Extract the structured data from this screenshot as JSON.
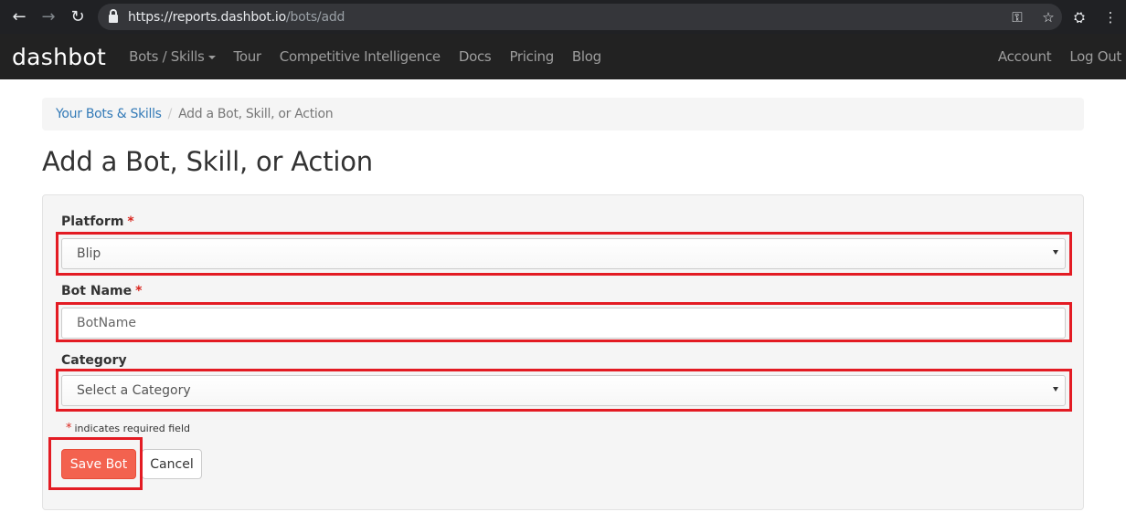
{
  "browser": {
    "url_host": "https://reports.dashbot.io",
    "url_path": "/bots/add",
    "icons": [
      "back-icon",
      "forward-icon",
      "reload-icon",
      "lock-icon",
      "key-icon",
      "star-icon",
      "extension-icon",
      "menu-icon"
    ]
  },
  "navbar": {
    "brand": "dashbot",
    "links": [
      "Bots / Skills",
      "Tour",
      "Competitive Intelligence",
      "Docs",
      "Pricing",
      "Blog"
    ],
    "right_links": [
      "Account",
      "Log Out"
    ]
  },
  "breadcrumb": {
    "parent": "Your Bots & Skills",
    "separator": "/",
    "current": "Add a Bot, Skill, or Action"
  },
  "page_title": "Add a Bot, Skill, or Action",
  "form": {
    "platform_label": "Platform",
    "platform_value": "Blip",
    "bot_name_label": "Bot Name",
    "bot_name_placeholder": "BotName",
    "category_label": "Category",
    "category_value": "Select a Category",
    "required_marker": "*",
    "required_hint": "indicates required field",
    "save_label": "Save Bot",
    "cancel_label": "Cancel"
  },
  "colors": {
    "navbar_bg": "#222222",
    "save_button": "#f3624f",
    "highlight": "#e31b23",
    "link": "#337ab7"
  }
}
